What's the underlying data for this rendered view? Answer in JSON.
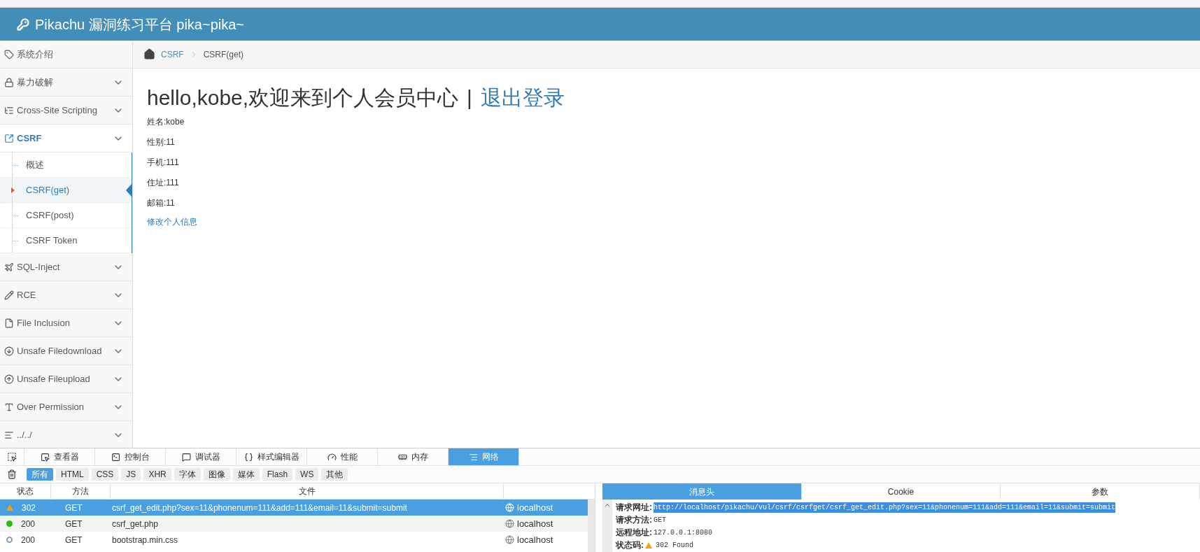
{
  "header": {
    "title": "Pikachu 漏洞练习平台 pika~pika~"
  },
  "sidebar": {
    "items": [
      {
        "label": "系统介绍",
        "selected": false,
        "chevron": false
      },
      {
        "label": "暴力破解",
        "selected": false,
        "chevron": true
      },
      {
        "label": "Cross-Site Scripting",
        "selected": false,
        "chevron": true
      },
      {
        "label": "CSRF",
        "selected": true,
        "chevron": true,
        "children": [
          {
            "label": "概述",
            "selected": false
          },
          {
            "label": "CSRF(get)",
            "selected": true
          },
          {
            "label": "CSRF(post)",
            "selected": false
          },
          {
            "label": "CSRF Token",
            "selected": false
          }
        ]
      },
      {
        "label": "SQL-Inject",
        "selected": false,
        "chevron": true
      },
      {
        "label": "RCE",
        "selected": false,
        "chevron": true
      },
      {
        "label": "File Inclusion",
        "selected": false,
        "chevron": true
      },
      {
        "label": "Unsafe Filedownload",
        "selected": false,
        "chevron": true
      },
      {
        "label": "Unsafe Fileupload",
        "selected": false,
        "chevron": true
      },
      {
        "label": "Over Permission",
        "selected": false,
        "chevron": true
      },
      {
        "label": "../../",
        "selected": false,
        "chevron": true
      }
    ]
  },
  "breadcrumb": [
    "CSRF",
    "CSRF(get)"
  ],
  "content": {
    "heading": "hello,kobe,欢迎来到个人会员中心",
    "separator": "|",
    "logout": "退出登录",
    "fields": [
      "姓名:kobe",
      "性别:11",
      "手机:111",
      "住址:111",
      "邮箱:11"
    ],
    "edit_link": "修改个人信息"
  },
  "devtools": {
    "tabs": [
      {
        "label": "查看器",
        "selected": false
      },
      {
        "label": "控制台",
        "selected": false
      },
      {
        "label": "调试器",
        "selected": false
      },
      {
        "label": "样式编辑器",
        "selected": false
      },
      {
        "label": "性能",
        "selected": false
      },
      {
        "label": "内存",
        "selected": false
      },
      {
        "label": "网络",
        "selected": true
      }
    ],
    "filters": [
      {
        "label": "所有",
        "selected": true
      },
      {
        "label": "HTML",
        "selected": false
      },
      {
        "label": "CSS",
        "selected": false
      },
      {
        "label": "JS",
        "selected": false
      },
      {
        "label": "XHR",
        "selected": false
      },
      {
        "label": "字体",
        "selected": false
      },
      {
        "label": "图像",
        "selected": false
      },
      {
        "label": "媒体",
        "selected": false
      },
      {
        "label": "Flash",
        "selected": false
      },
      {
        "label": "WS",
        "selected": false
      },
      {
        "label": "其他",
        "selected": false
      }
    ],
    "columns": [
      "状态",
      "方法",
      "文件"
    ],
    "rows": [
      {
        "kind": "warning",
        "status": "302",
        "method": "GET",
        "file": "csrf_get_edit.php?sex=11&phonenum=111&add=111&email=11&submit=submit",
        "domain": "localhost",
        "selected": true
      },
      {
        "kind": "ok",
        "status": "200",
        "method": "GET",
        "file": "csrf_get.php",
        "domain": "localhost",
        "selected": false
      },
      {
        "kind": "cached",
        "status": "200",
        "method": "GET",
        "file": "bootstrap.min.css",
        "domain": "localhost",
        "selected": false
      }
    ],
    "detail": {
      "tabs": [
        {
          "label": "消息头",
          "selected": true
        },
        {
          "label": "Cookie",
          "selected": false
        },
        {
          "label": "参数",
          "selected": false
        }
      ],
      "lines": [
        {
          "label": "请求网址:",
          "value": "http://localhost/pikachu/vul/csrf/csrfget/csrf_get_edit.php?sex=11&phonenum=111&add=111&email=11&submit=submit",
          "highlighted": true,
          "kind": "plain"
        },
        {
          "label": "请求方法:",
          "value": "GET",
          "highlighted": false,
          "kind": "plain"
        },
        {
          "label": "远程地址:",
          "value": "127.0.0.1:8080",
          "highlighted": false,
          "kind": "plain"
        },
        {
          "label": "状态码:",
          "value": "302 Found",
          "highlighted": false,
          "kind": "warning"
        }
      ]
    }
  }
}
